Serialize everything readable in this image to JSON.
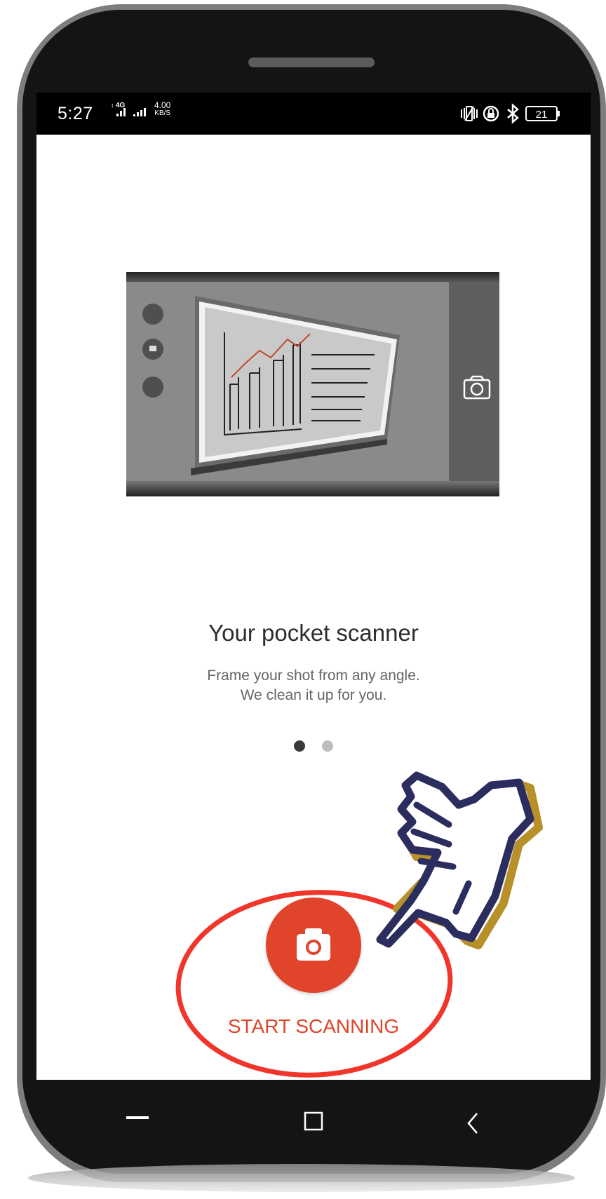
{
  "status_bar": {
    "time": "5:27",
    "network": "4G",
    "speed_value": "4.00",
    "speed_unit": "KB/S",
    "battery": "21"
  },
  "onboarding": {
    "title": "Your pocket scanner",
    "subtitle_line1": "Frame your shot from any angle.",
    "subtitle_line2": "We clean it up for you.",
    "page_count": 2,
    "current_page": 1
  },
  "actions": {
    "start_scanning_label": "START SCANNING"
  },
  "icons": {
    "illustration": "whiteboard-scan-illustration",
    "fab": "camera-icon",
    "nav_recents": "menu-line-icon",
    "nav_home": "square-icon",
    "nav_back": "chevron-left-icon"
  },
  "colors": {
    "accent": "#e0442b",
    "annotation_circle": "#f0352b",
    "hand_outline": "#2a2d5e",
    "hand_shadow": "#b8902a"
  }
}
